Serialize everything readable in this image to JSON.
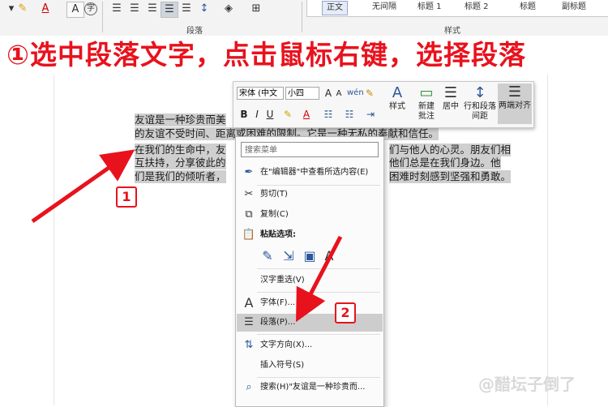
{
  "ribbon": {
    "group_paragraph_label": "段落",
    "group_styles_label": "样式",
    "styles": [
      "正文",
      "无间隔",
      "标题 1",
      "标题 2",
      "标题",
      "副标题"
    ],
    "icons": [
      "highlight-icon",
      "font-color-icon",
      "char-shading-icon",
      "enclose-char-icon",
      "align-left-icon",
      "align-center-icon",
      "align-right-icon",
      "justify-icon",
      "distributed-icon",
      "line-spacing-icon",
      "shading-icon",
      "borders-icon"
    ]
  },
  "banner": {
    "text": "①选中段落文字，点击鼠标右键，选择段落",
    "color": "#e8121d"
  },
  "document": {
    "lines": [
      "友谊是一种珍贵而美",
      "的友谊不受时间、距离或困难的限制。它是一种无私的奉献和信任。",
      "在我们的生命中，友",
      "们与他人的心灵。朋友们相",
      "互扶持，分享彼此的",
      "他们总是在我们身边。他",
      "们是我们的倾听者，",
      "困难时刻感到坚强和勇敢。"
    ]
  },
  "mini_toolbar": {
    "font_name": "宋体 (中文",
    "font_size": "小四",
    "grow_font": "A",
    "shrink_font": "A",
    "bold": "B",
    "italic": "I",
    "underline": "U",
    "font_color": "A",
    "styles_label": "样式",
    "new_comment_label": "新建\n批注",
    "center_label": "居中",
    "line_spacing_label": "行和段落\n间距",
    "justify_label": "两端对齐"
  },
  "context_menu": {
    "search_placeholder": "搜索菜单",
    "items": {
      "search_editor": "在\"编辑器\"中查看所选内容(E)",
      "cut": "剪切(T)",
      "copy": "复制(C)",
      "paste_options": "粘贴选项:",
      "reconvert": "汉字重选(V)",
      "font": "字体(F)...",
      "paragraph": "段落(P)...",
      "text_direction": "文字方向(X)...",
      "insert_symbol": "插入符号(S)",
      "search_text": "搜索(H)\"友谊是一种珍贵而..."
    }
  },
  "annotations": {
    "badge1": "1",
    "badge2": "2",
    "arrow_color": "#e8121d"
  },
  "watermark": "@醋坛子倒了"
}
